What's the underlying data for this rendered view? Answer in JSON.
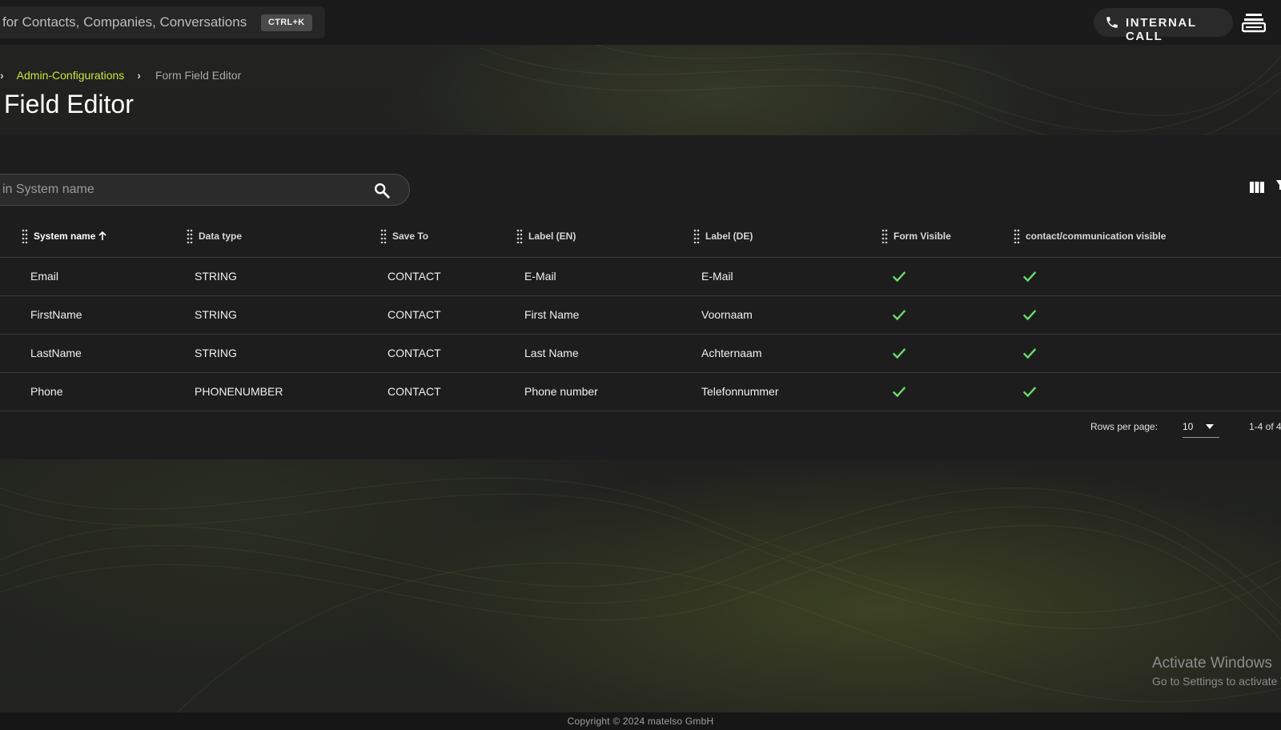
{
  "topbar": {
    "search_text": "for Contacts, Companies, Conversations",
    "shortcut": "CTRL+K",
    "internal_call_label": "INTERNAL CALL"
  },
  "breadcrumb": {
    "link": "Admin-Configurations",
    "current": "Form Field Editor"
  },
  "page_title": "Field Editor",
  "filter": {
    "placeholder": "in System name"
  },
  "table": {
    "columns": [
      {
        "label": "System name",
        "sorted": "asc"
      },
      {
        "label": "Data type"
      },
      {
        "label": "Save To"
      },
      {
        "label": "Label (EN)"
      },
      {
        "label": "Label (DE)"
      },
      {
        "label": "Form Visible"
      },
      {
        "label": "contact/communication visible"
      }
    ],
    "rows": [
      {
        "system_name": "Email",
        "data_type": "STRING",
        "save_to": "CONTACT",
        "label_en": "E-Mail",
        "label_de": "E-Mail",
        "form_visible": true,
        "contact_visible": true
      },
      {
        "system_name": "FirstName",
        "data_type": "STRING",
        "save_to": "CONTACT",
        "label_en": "First Name",
        "label_de": "Voornaam",
        "form_visible": true,
        "contact_visible": true
      },
      {
        "system_name": "LastName",
        "data_type": "STRING",
        "save_to": "CONTACT",
        "label_en": "Last Name",
        "label_de": "Achternaam",
        "form_visible": true,
        "contact_visible": true
      },
      {
        "system_name": "Phone",
        "data_type": "PHONENUMBER",
        "save_to": "CONTACT",
        "label_en": "Phone number",
        "label_de": "Telefonnummer",
        "form_visible": true,
        "contact_visible": true
      }
    ]
  },
  "pagination": {
    "rows_per_page_label": "Rows per page:",
    "rows_per_page": "10",
    "range": "1-4 of 4"
  },
  "watermark": {
    "title": "Activate Windows",
    "subtitle": "Go to Settings to activate Windows."
  },
  "footer": {
    "copyright": "Copyright © 2024 matelso GmbH"
  },
  "colors": {
    "accent": "#c8e63a",
    "check": "#6bdc6b",
    "background": "#1b1c1b"
  }
}
